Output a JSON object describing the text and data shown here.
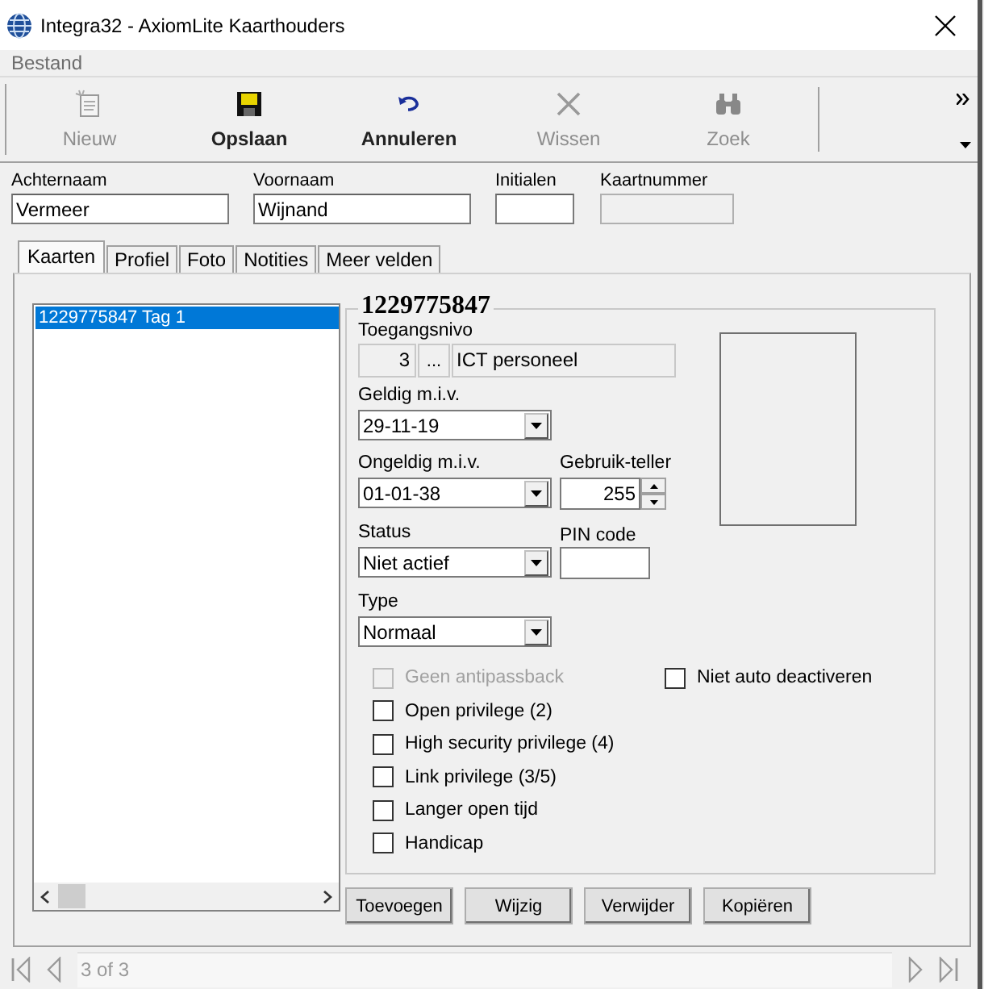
{
  "window": {
    "title": "Integra32 - AxiomLite Kaarthouders"
  },
  "menu": [
    {
      "label": "Bestand",
      "disabled": true
    }
  ],
  "toolbar": [
    {
      "kind": "new",
      "label": "Nieuw",
      "disabled": true
    },
    {
      "kind": "save",
      "label": "Opslaan",
      "disabled": false
    },
    {
      "kind": "undo",
      "label": "Annuleren",
      "disabled": false
    },
    {
      "kind": "delete",
      "label": "Wissen",
      "disabled": true
    },
    {
      "kind": "find",
      "label": "Zoek",
      "disabled": true
    }
  ],
  "fields": [
    {
      "label": "Achternaam",
      "value": "Vermeer",
      "disabled": false
    },
    {
      "label": "Voornaam",
      "value": "Wijnand",
      "disabled": false
    },
    {
      "label": "Initialen",
      "disabled": false
    },
    {
      "label": "Kaartnummer",
      "disabled": true
    }
  ],
  "tabs": [
    {
      "label": "Kaarten",
      "selected": true
    },
    {
      "label": "Profiel",
      "selected": false
    },
    {
      "label": "Foto",
      "selected": false
    },
    {
      "label": "Notities",
      "selected": false
    },
    {
      "label": "Meer velden",
      "selected": false
    }
  ],
  "card_list": {
    "items": [
      {
        "label": "1229775847  Tag 1",
        "selected": true
      }
    ]
  },
  "card": {
    "title": "1229775847",
    "access_level": {
      "label": "Toegangsnivo",
      "number": "3",
      "browse": "...",
      "name": "ICT personeel"
    },
    "valid_from": {
      "label": "Geldig m.i.v.",
      "value": "29-11-19"
    },
    "valid_until": {
      "label": "Ongeldig m.i.v.",
      "value": "01-01-38"
    },
    "use_counter": {
      "label": "Gebruik-teller",
      "value": "255"
    },
    "status": {
      "label": "Status",
      "value": "Niet actief"
    },
    "pin": {
      "label": "PIN code"
    },
    "type": {
      "label": "Type",
      "value": "Normaal"
    },
    "checkboxes": [
      {
        "label": "Geen antipassback",
        "checked": false,
        "disabled": true
      },
      {
        "label": "Niet auto deactiveren",
        "checked": false,
        "disabled": false
      },
      {
        "label": "Open privilege (2)",
        "checked": false,
        "disabled": false
      },
      {
        "label": "High security privilege (4)",
        "checked": false,
        "disabled": false
      },
      {
        "label": "Link privilege (3/5)",
        "checked": false,
        "disabled": false
      },
      {
        "label": "Langer open tijd",
        "checked": false,
        "disabled": false
      },
      {
        "label": "Handicap",
        "checked": false,
        "disabled": false
      }
    ]
  },
  "card_buttons": [
    "Toevoegen",
    "Wijzig",
    "Verwijder",
    "Kopiëren"
  ],
  "navigator": {
    "position": "3 of 3"
  }
}
